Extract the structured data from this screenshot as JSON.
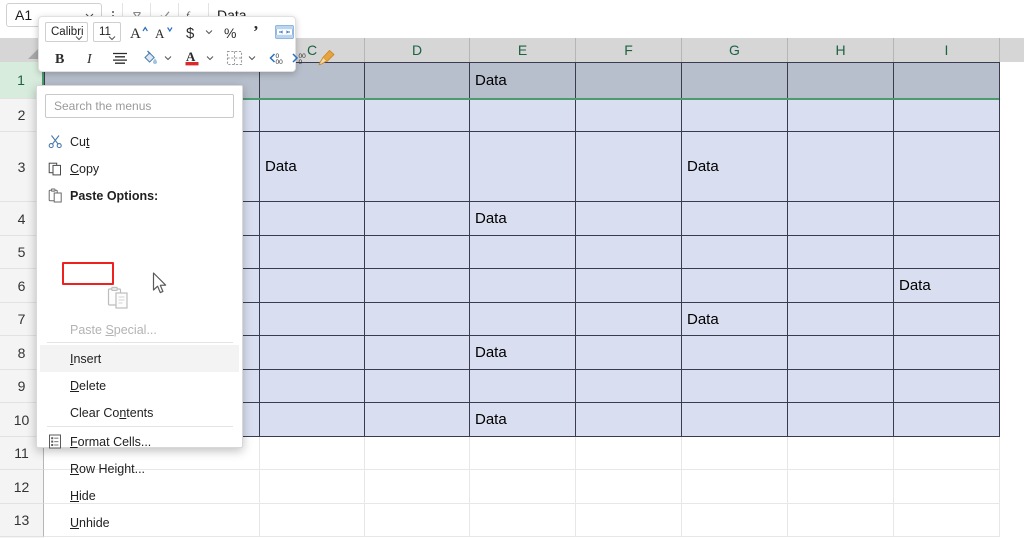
{
  "app": "Microsoft Excel",
  "formula_bar": {
    "name_box_value": "A1",
    "name_box_icon": "chevron-down-icon",
    "more_icon": "vertical-ellipsis-icon",
    "cancel_icon": "cancel-icon",
    "enter_icon": "check-icon",
    "function_icon": "fx-icon",
    "formula_value": "Data"
  },
  "mini_toolbar": {
    "font_name": "Calibri",
    "font_size": "11",
    "buttons": [
      {
        "name": "increase-font-size-icon",
        "label": "A"
      },
      {
        "name": "decrease-font-size-icon",
        "label": "A"
      },
      {
        "name": "accounting-format-icon",
        "label": "$"
      },
      {
        "name": "accounting-dropdown-icon",
        "label": ""
      },
      {
        "name": "percent-style-icon",
        "label": "%"
      },
      {
        "name": "comma-style-icon",
        "label": "’"
      },
      {
        "name": "merge-and-center-icon",
        "label": ""
      },
      {
        "name": "bold-icon",
        "label": "B"
      },
      {
        "name": "italic-icon",
        "label": "I"
      },
      {
        "name": "center-align-icon",
        "label": ""
      },
      {
        "name": "fill-color-icon",
        "label": ""
      },
      {
        "name": "fill-color-dropdown-icon",
        "label": ""
      },
      {
        "name": "font-color-icon",
        "label": "A"
      },
      {
        "name": "font-color-dropdown-icon",
        "label": ""
      },
      {
        "name": "borders-icon",
        "label": ""
      },
      {
        "name": "borders-dropdown-icon",
        "label": ""
      },
      {
        "name": "decrease-decimal-icon",
        "label": ""
      },
      {
        "name": "increase-decimal-icon",
        "label": ""
      },
      {
        "name": "format-painter-icon",
        "label": ""
      }
    ],
    "font_color_swatch": "#d92b2b",
    "format_painter_color": "#e8a33d"
  },
  "context_menu": {
    "search_placeholder": "Search the menus",
    "items": [
      {
        "label": "Cut",
        "accel": "t",
        "icon": "scissors-icon",
        "state": "normal"
      },
      {
        "label": "Copy",
        "accel": "C",
        "icon": "copy-icon",
        "state": "normal"
      },
      {
        "label": "Paste Options:",
        "accel": "",
        "icon": "clipboard-icon",
        "state": "header"
      },
      {
        "label": "Paste Special...",
        "accel": "S",
        "icon": "",
        "state": "disabled"
      },
      {
        "label": "Insert",
        "accel": "I",
        "icon": "",
        "state": "highlighted"
      },
      {
        "label": "Delete",
        "accel": "D",
        "icon": "",
        "state": "normal"
      },
      {
        "label": "Clear Contents",
        "accel": "n",
        "icon": "",
        "state": "normal"
      },
      {
        "label": "Format Cells...",
        "accel": "F",
        "icon": "format-cells-icon",
        "state": "normal"
      },
      {
        "label": "Row Height...",
        "accel": "R",
        "icon": "",
        "state": "normal"
      },
      {
        "label": "Hide",
        "accel": "H",
        "icon": "",
        "state": "normal"
      },
      {
        "label": "Unhide",
        "accel": "U",
        "icon": "",
        "state": "normal"
      }
    ],
    "paste_option_icon": "paste-clipboard-icon",
    "highlight_color": "#ef2020"
  },
  "sheet": {
    "columns": [
      "C",
      "D",
      "E",
      "F",
      "G",
      "H",
      "I"
    ],
    "rows": [
      "1",
      "2",
      "3",
      "4",
      "5",
      "6",
      "7",
      "8",
      "9",
      "10",
      "11",
      "12",
      "13"
    ],
    "selected_row": "1",
    "cell_text": "Data",
    "filled_cells": [
      {
        "row": "1",
        "col": "E"
      },
      {
        "row": "3",
        "col": "C"
      },
      {
        "row": "3",
        "col": "G"
      },
      {
        "row": "4",
        "col": "E"
      },
      {
        "row": "6",
        "col": "I"
      },
      {
        "row": "7",
        "col": "G"
      },
      {
        "row": "8",
        "col": "E"
      },
      {
        "row": "10",
        "col": "E"
      }
    ],
    "selection_fill": "#d9dff0",
    "active_row_fill": "#b7bfcc",
    "header_accent": "#4a9c6d"
  }
}
